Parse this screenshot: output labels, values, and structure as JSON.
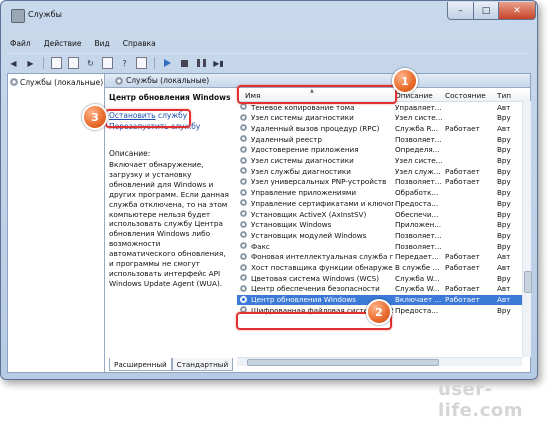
{
  "window": {
    "title": "Службы"
  },
  "menu": [
    "Файл",
    "Действие",
    "Вид",
    "Справка"
  ],
  "left_tree": {
    "label": "Службы (локальные)"
  },
  "panel_header": "Службы (локальные)",
  "description": {
    "title": "Центр обновления Windows",
    "link_start": "Остановить",
    "link_start_rest": " службу",
    "link_restart": "Перезапустить службу",
    "label": "Описание:",
    "text": "Включает обнаружение, загрузку и установку обновлений для Windows и других программ. Если данная служба отключена, то на этом компьютере нельзя будет использовать службу Центра обновления Windows либо возможности автоматического обновления, и программы не смогут использовать интерфейс API Windows Update Agent (WUA)."
  },
  "table": {
    "columns": [
      "Имя",
      "Описание",
      "Состояние",
      "Тип"
    ],
    "rows": [
      [
        "Теневое копирование тома",
        "Управляет...",
        "",
        "Авт"
      ],
      [
        "Узел системы диагностики",
        "Узел систе...",
        "",
        "Вру"
      ],
      [
        "Удаленный вызов процедур (RPC)",
        "Служба R...",
        "Работает",
        "Авт"
      ],
      [
        "Удаленный реестр",
        "Позволяет...",
        "",
        "Вру"
      ],
      [
        "Удостоверение приложения",
        "Определя...",
        "",
        "Вру"
      ],
      [
        "Узел системы диагностики",
        "Узел систе...",
        "",
        "Вру"
      ],
      [
        "Узел службы диагностики",
        "Узел служ...",
        "Работает",
        "Вру"
      ],
      [
        "Узел универсальных PNP-устройств",
        "Позволяет...",
        "Работает",
        "Вру"
      ],
      [
        "Управление приложениями",
        "Обработк...",
        "",
        "Вру"
      ],
      [
        "Управление сертификатами и ключом ...",
        "Предоста...",
        "",
        "Вру"
      ],
      [
        "Установщик ActiveX (AxInstSV)",
        "Обеспечи...",
        "",
        "Вру"
      ],
      [
        "Установщик Windows",
        "Приложен...",
        "",
        "Вру"
      ],
      [
        "Установщик модулей Windows",
        "Позволяет...",
        "",
        "Вру"
      ],
      [
        "Факс",
        "Позволяет...",
        "",
        "Вру"
      ],
      [
        "Фоновая интеллектуальная служба пе...",
        "Передает...",
        "Работает",
        "Авт"
      ],
      [
        "Хост поставщика функции обнаружения",
        "В службе ...",
        "Работает",
        "Авт"
      ],
      [
        "Цветовая система Windows (WCS)",
        "Служба W...",
        "",
        "Вру"
      ],
      [
        "Центр обеспечения безопасности",
        "Служба W...",
        "Работает",
        "Авт"
      ],
      [
        "Центр обновления Windows",
        "Включает ...",
        "Работает",
        "Авт"
      ],
      [
        "Шифрованная файловая система (EFS)",
        "Предоста...",
        "",
        "Вру"
      ]
    ],
    "selected_row": 18
  },
  "tabs": [
    "Расширенный",
    "Стандартный"
  ],
  "callouts": [
    "1",
    "2",
    "3"
  ],
  "watermark": "user-life.com"
}
